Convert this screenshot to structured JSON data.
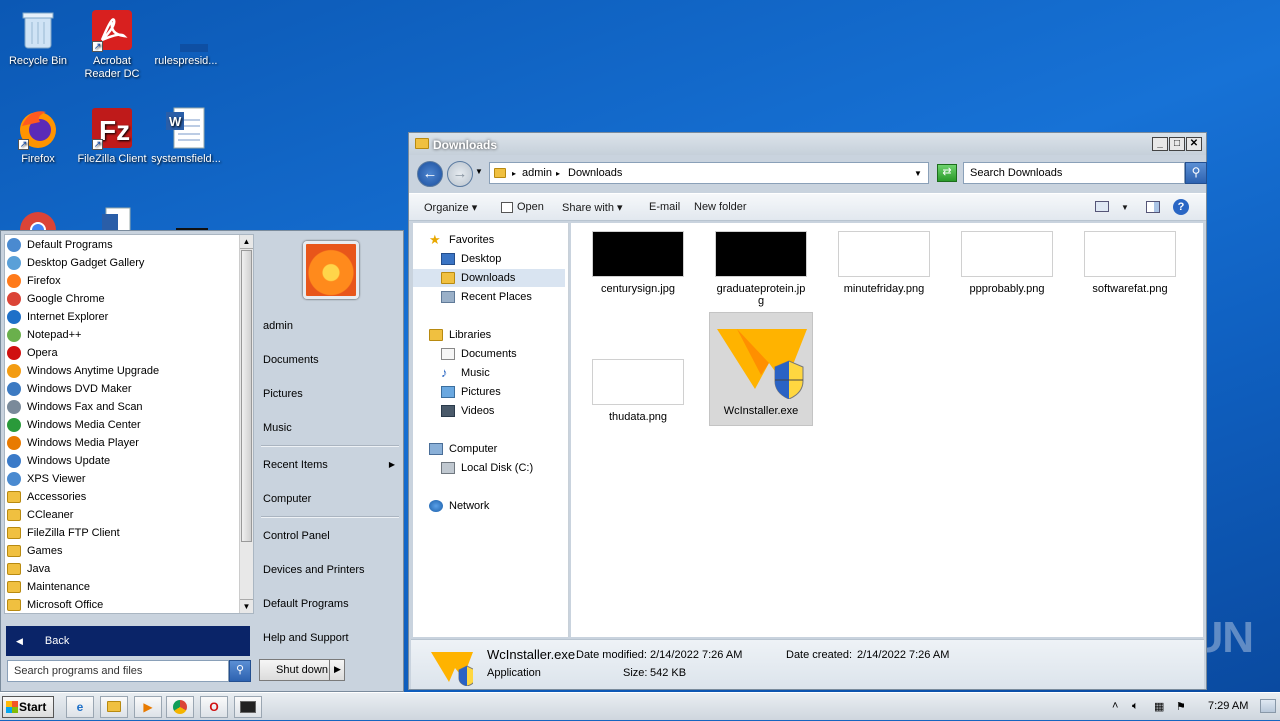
{
  "desktop": {
    "icons": [
      {
        "label": "Recycle Bin",
        "icon": "recycle-bin-icon"
      },
      {
        "label": "Acrobat Reader DC",
        "icon": "acrobat-icon"
      },
      {
        "label": "rulespresid...",
        "icon": "document-icon"
      },
      {
        "label": "Firefox",
        "icon": "firefox-icon"
      },
      {
        "label": "FileZilla Client",
        "icon": "filezilla-icon"
      },
      {
        "label": "systemsfield...",
        "icon": "word-icon"
      }
    ],
    "watermark": "ANY▷RUN"
  },
  "explorer": {
    "title": "Downloads",
    "address": {
      "root": "admin",
      "current": "Downloads"
    },
    "search_placeholder": "Search Downloads",
    "toolbar": {
      "organize": "Organize",
      "open": "Open",
      "share_with": "Share with",
      "email": "E-mail",
      "new_folder": "New folder"
    },
    "nav": {
      "favorites": "Favorites",
      "desktop": "Desktop",
      "downloads": "Downloads",
      "recent_places": "Recent Places",
      "libraries": "Libraries",
      "documents": "Documents",
      "music": "Music",
      "pictures": "Pictures",
      "videos": "Videos",
      "computer": "Computer",
      "local_disk": "Local Disk (C:)",
      "network": "Network"
    },
    "files": [
      {
        "name": "centurysign.jpg"
      },
      {
        "name": "graduateprotein.jpg"
      },
      {
        "name": "minutefriday.png"
      },
      {
        "name": "ppprobably.png"
      },
      {
        "name": "softwarefat.png"
      },
      {
        "name": "thudata.png"
      },
      {
        "name": "WcInstaller.exe"
      }
    ],
    "details": {
      "name": "WcInstaller.exe",
      "type": "Application",
      "modified_label": "Date modified:",
      "modified": "2/14/2022 7:26 AM",
      "created_label": "Date created:",
      "created": "2/14/2022 7:26 AM",
      "size_label": "Size:",
      "size": "542 KB"
    }
  },
  "start_menu": {
    "programs": [
      "Default Programs",
      "Desktop Gadget Gallery",
      "Firefox",
      "Google Chrome",
      "Internet Explorer",
      "Notepad++",
      "Opera",
      "Windows Anytime Upgrade",
      "Windows DVD Maker",
      "Windows Fax and Scan",
      "Windows Media Center",
      "Windows Media Player",
      "Windows Update",
      "XPS Viewer",
      "Accessories",
      "CCleaner",
      "FileZilla FTP Client",
      "Games",
      "Java",
      "Maintenance",
      "Microsoft Office"
    ],
    "back": "Back",
    "search_placeholder": "Search programs and files",
    "right": {
      "user": "admin",
      "documents": "Documents",
      "pictures": "Pictures",
      "music": "Music",
      "recent_items": "Recent Items",
      "computer": "Computer",
      "control_panel": "Control Panel",
      "devices_printers": "Devices and Printers",
      "default_programs": "Default Programs",
      "help_support": "Help and Support"
    },
    "shutdown": "Shut down"
  },
  "taskbar": {
    "start": "Start",
    "clock": "7:29 AM"
  }
}
